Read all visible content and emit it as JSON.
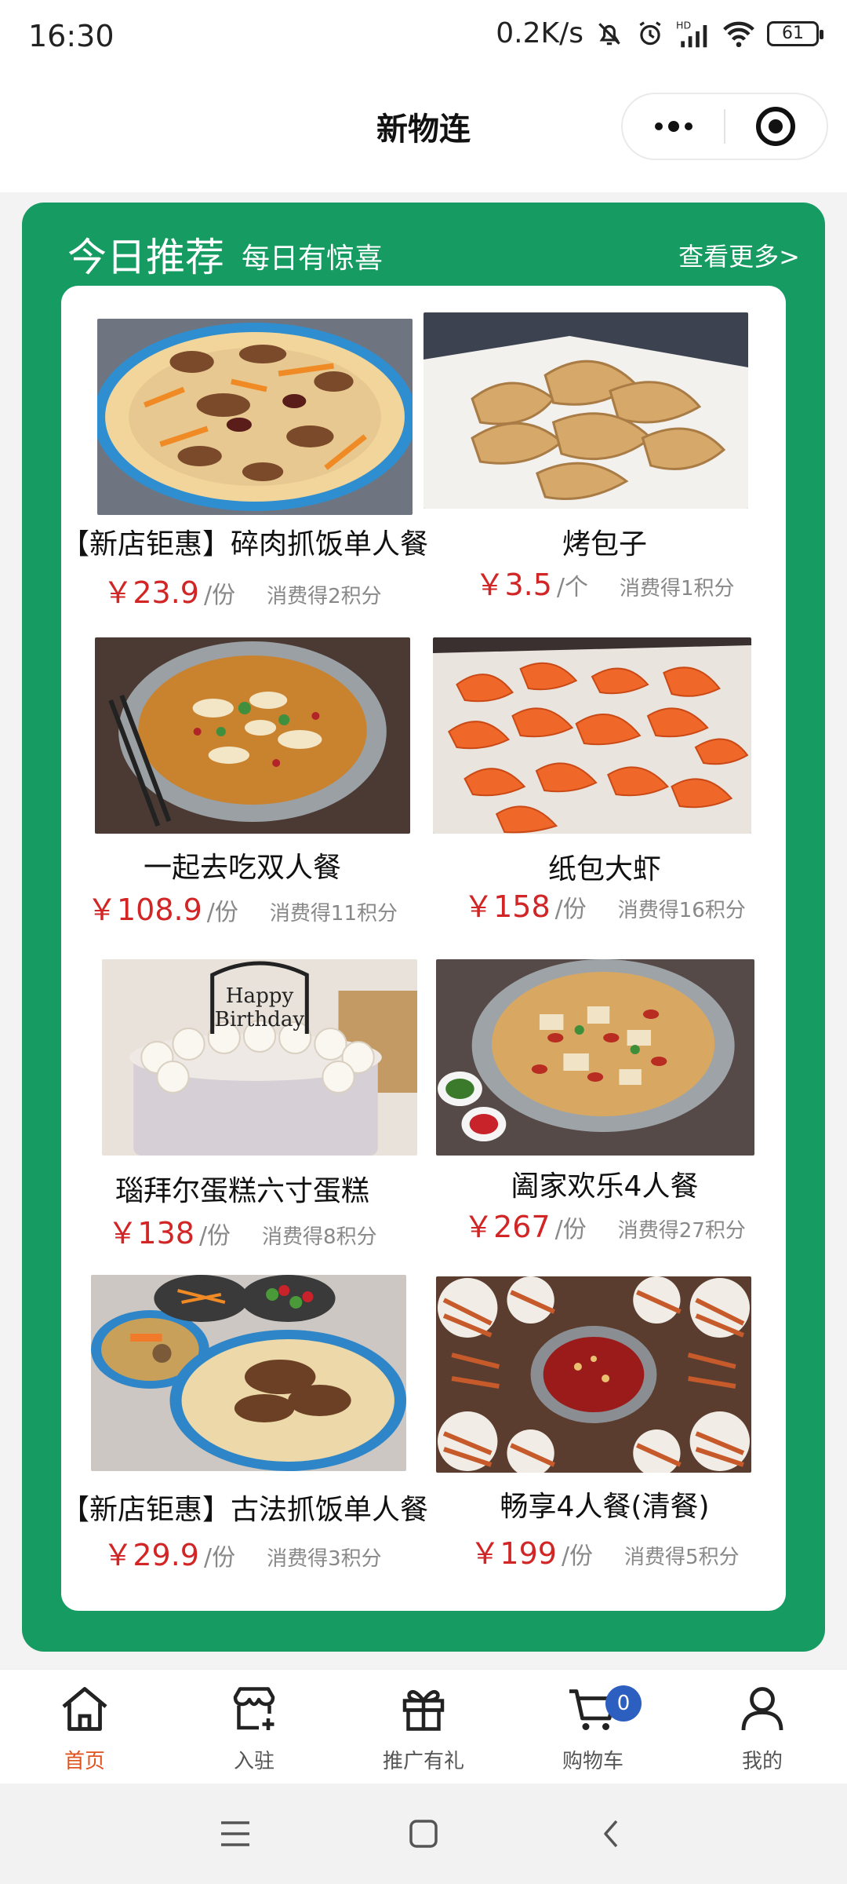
{
  "status_bar": {
    "time": "16:30",
    "net_speed": "0.2K/s",
    "battery": "61",
    "icons": [
      "mute-bell-icon",
      "alarm-icon",
      "hd-signal-icon",
      "wifi-icon",
      "battery-icon"
    ]
  },
  "nav": {
    "title": "新物连"
  },
  "recommend": {
    "title": "今日推荐",
    "subtitle": "每日有惊喜",
    "more": "查看更多>",
    "items": [
      {
        "name": "【新店钜惠】碎肉抓饭单人餐",
        "price": "￥23.9",
        "unit": "/份",
        "points": "消费得2积分",
        "image": "pilaf-plate"
      },
      {
        "name": "烤包子",
        "price": "￥3.5",
        "unit": "/个",
        "points": "消费得1积分",
        "image": "baked-buns"
      },
      {
        "name": "一起去吃双人餐",
        "price": "￥108.9",
        "unit": "/份",
        "points": "消费得11积分",
        "image": "chicken-pan"
      },
      {
        "name": "纸包大虾",
        "price": "￥158",
        "unit": "/份",
        "points": "消费得16积分",
        "image": "shrimp"
      },
      {
        "name": "瑙拜尔蛋糕六寸蛋糕",
        "price": "￥138",
        "unit": "/份",
        "points": "消费得8积分",
        "image": "birthday-cake"
      },
      {
        "name": "阖家欢乐4人餐",
        "price": "￥267",
        "unit": "/份",
        "points": "消费得27积分",
        "image": "pepper-chicken-pan"
      },
      {
        "name": "【新店钜惠】古法抓饭单人餐",
        "price": "￥29.9",
        "unit": "/份",
        "points": "消费得3积分",
        "image": "pilaf-set"
      },
      {
        "name": "畅享4人餐(清餐)",
        "price": "￥199",
        "unit": "/份",
        "points": "消费得5积分",
        "image": "skewer-hotpot"
      }
    ]
  },
  "tabbar": {
    "tabs": [
      {
        "label": "首页",
        "icon": "home-icon"
      },
      {
        "label": "入驻",
        "icon": "store-add-icon"
      },
      {
        "label": "推广有礼",
        "icon": "gift-icon"
      },
      {
        "label": "购物车",
        "icon": "cart-icon"
      },
      {
        "label": "我的",
        "icon": "user-icon"
      }
    ],
    "cart_badge": "0",
    "active_color": "#e0531f"
  },
  "colors": {
    "accent_green": "#169c62",
    "price_red": "#d22525"
  }
}
